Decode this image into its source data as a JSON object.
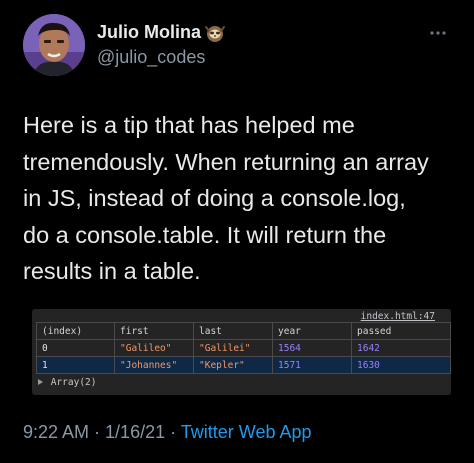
{
  "author": {
    "display_name": "Julio Molina",
    "handle": "@julio_codes",
    "emoji_icon": "sloth-icon"
  },
  "tweet": {
    "lines": [
      "Here is a tip that has helped me",
      "tremendously. When returning an array",
      "in JS, instead of doing a console.log,",
      "do a console.table. It will return the",
      "results in a table."
    ]
  },
  "console": {
    "source": "index.html:47",
    "columns": [
      "(index)",
      "first",
      "last",
      "year",
      "passed"
    ],
    "rows": [
      [
        "0",
        "\"Galileo\"",
        "\"Galilei\"",
        "1564",
        "1642"
      ],
      [
        "1",
        "\"Johannes\"",
        "\"Kepler\"",
        "1571",
        "1630"
      ]
    ],
    "array_label": "Array(2)"
  },
  "meta": {
    "time": "9:22 AM",
    "sep1": " · ",
    "date": "1/16/21",
    "sep2": " · ",
    "app": "Twitter Web App"
  },
  "colors": {
    "background": "#000000",
    "text": "#e7e9ea",
    "muted": "#8b98a5",
    "link": "#1d9bf0",
    "console_string": "#f29766",
    "console_number": "#9980ff",
    "console_selected_row": "#0e2845"
  }
}
